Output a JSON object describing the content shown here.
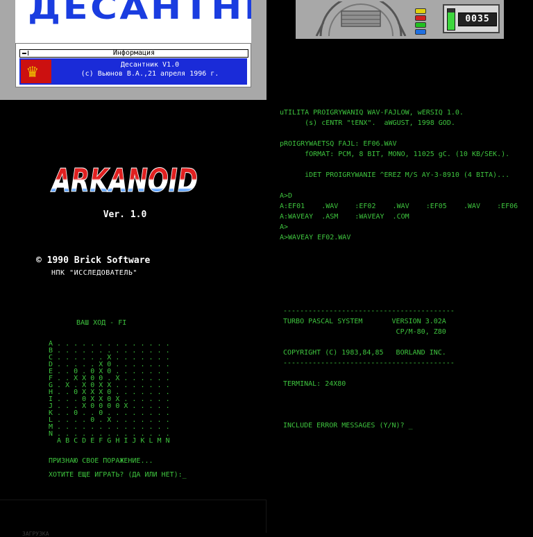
{
  "desantnik": {
    "logo": "ДЕСАНТНИК",
    "dialog_title": "Информация",
    "line1": "Десантник V1.0",
    "line2": "(c) Вьюнов В.А.,21 апреля 1996 г.",
    "icon": "double-headed-eagle-icon"
  },
  "tape": {
    "counter": "0035",
    "level_fraction": 0.85,
    "led_colors": [
      "#e0d010",
      "#d02020",
      "#20c020",
      "#2070e0"
    ]
  },
  "arkanoid": {
    "logo": "ARKANOID",
    "version": "Ver. 1.0",
    "copyright": "© 1990 Brick Software",
    "org": "НПК \"ИССЛЕДОВАТЕЛЬ\""
  },
  "util": {
    "lines": [
      "uTILITA PROIGRYWANIQ WAV-FAJLOW, wERSIQ 1.0.",
      "      (s) cENTR \"tENX\".  aWGUST, 1998 GOD.",
      "",
      "pROIGRYWAETSQ FAJL: EF06.WAV",
      "      fORMAT: PCM, 8 BIT, MONO, 11025 gC. (10 KB/SEK.).",
      "",
      "      iDET PROIGRYWANIE ^EREZ M/S AY-3-8910 (4 BITA)...",
      "",
      "A>D",
      "A:EF01    .WAV    :EF02    .WAV    :EF05    .WAV    :EF06    .WAV",
      "A:WAVEAY  .ASM    :WAVEAY  .COM",
      "A>",
      "A>WAVEAY EF02.WAV"
    ]
  },
  "turbo": {
    "lines": [
      "-----------------------------------------",
      "TURBO PASCAL SYSTEM       VERSION 3.02A",
      "                           CP/M-80, Z80",
      "",
      "COPYRIGHT (C) 1983,84,85   BORLAND INC.",
      "-----------------------------------------",
      "",
      "TERMINAL: 24X80",
      "",
      "",
      "",
      "INCLUDE ERROR MESSAGES (Y/N)? _"
    ]
  },
  "seabattle": {
    "title": "ВАШ ХОД - FI",
    "rows": [
      "A . . . . . . . . . . . . . .",
      "B . . . . . . . . . . . . . .",
      "C . . . . . . X . . . . . . .",
      "D . . . . . X 0 . . . . . . .",
      "E . . 0 . 0 X 0 . . . . . . .",
      "F . . X X 0 0 . X . . . . . .",
      "G . X . X 0 X X . . . . . . .",
      "H . . 0 X X X 0 . . . . . . .",
      "I . . . 0 X X 0 X . . . . . .",
      "J . . . X 0 0 0 0 X . . . . .",
      "K . . 0 . . 0 . . . . . . . .",
      "L . . . . 0 . X . . . . . . .",
      "M . . . . . . . . . . . . . .",
      "N . . . . . . . . . . . . . .",
      "  A B C D E F G H I J K L M N"
    ],
    "msg1": "ПРИЗНАЮ СВОЕ ПОРАЖЕНИЕ...",
    "msg2": "ХОТИТЕ ЕЩЕ ИГРАТЬ? (ДА ИЛИ НЕТ):_"
  },
  "bottom": {
    "text": "ЗАГРУЗКА"
  }
}
